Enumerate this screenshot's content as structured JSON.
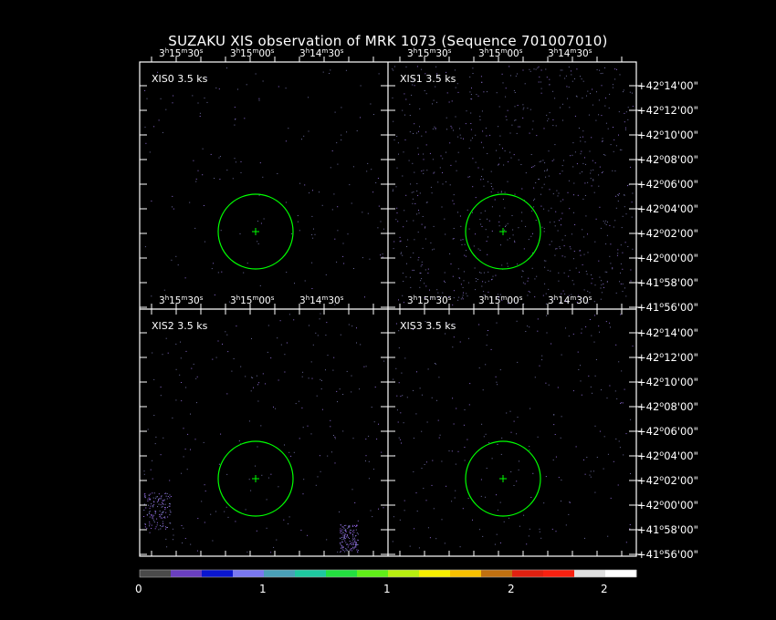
{
  "title": "SUZAKU XIS observation of MRK 1073  (Sequence 701007010)",
  "ra_ticks": [
    {
      "h": "3",
      "m": "15",
      "s": "30"
    },
    {
      "h": "3",
      "m": "15",
      "s": "00"
    },
    {
      "h": "3",
      "m": "14",
      "s": "30"
    }
  ],
  "dec_ticks_top": [
    "+42°14′00″",
    "+42°12′00″",
    "+42°10′00″",
    "+42°08′00″",
    "+42°06′00″",
    "+42°04′00″",
    "+42°02′00″",
    "+42°00′00″",
    "+41°58′00″",
    "+41°56′00″"
  ],
  "dec_ticks_bottom": [
    "+42°14′00″",
    "+42°12′00″",
    "+42°10′00″",
    "+42°08′00″",
    "+42°06′00″",
    "+42°04′00″",
    "+42°02′00″",
    "+42°00′00″",
    "+41°58′00″",
    "+41°56′00″"
  ],
  "panels": [
    {
      "label": "XIS0 3.5 ks"
    },
    {
      "label": "XIS1 3.5 ks"
    },
    {
      "label": "XIS2 3.5 ks"
    },
    {
      "label": "XIS3 3.5 ks"
    }
  ],
  "colorbar": {
    "colors": [
      "#4a4a4a",
      "#6a3fc0",
      "#0a16d0",
      "#7a78f0",
      "#4aa0b8",
      "#1ec8a0",
      "#23e040",
      "#60f018",
      "#b8f010",
      "#f8f000",
      "#f8c000",
      "#c07010",
      "#e02010",
      "#f82010",
      "#e0e0e0",
      "#ffffff"
    ],
    "ticks": [
      "0",
      "1",
      "1",
      "2",
      "2"
    ]
  },
  "source_marker_color": "#00ff00"
}
